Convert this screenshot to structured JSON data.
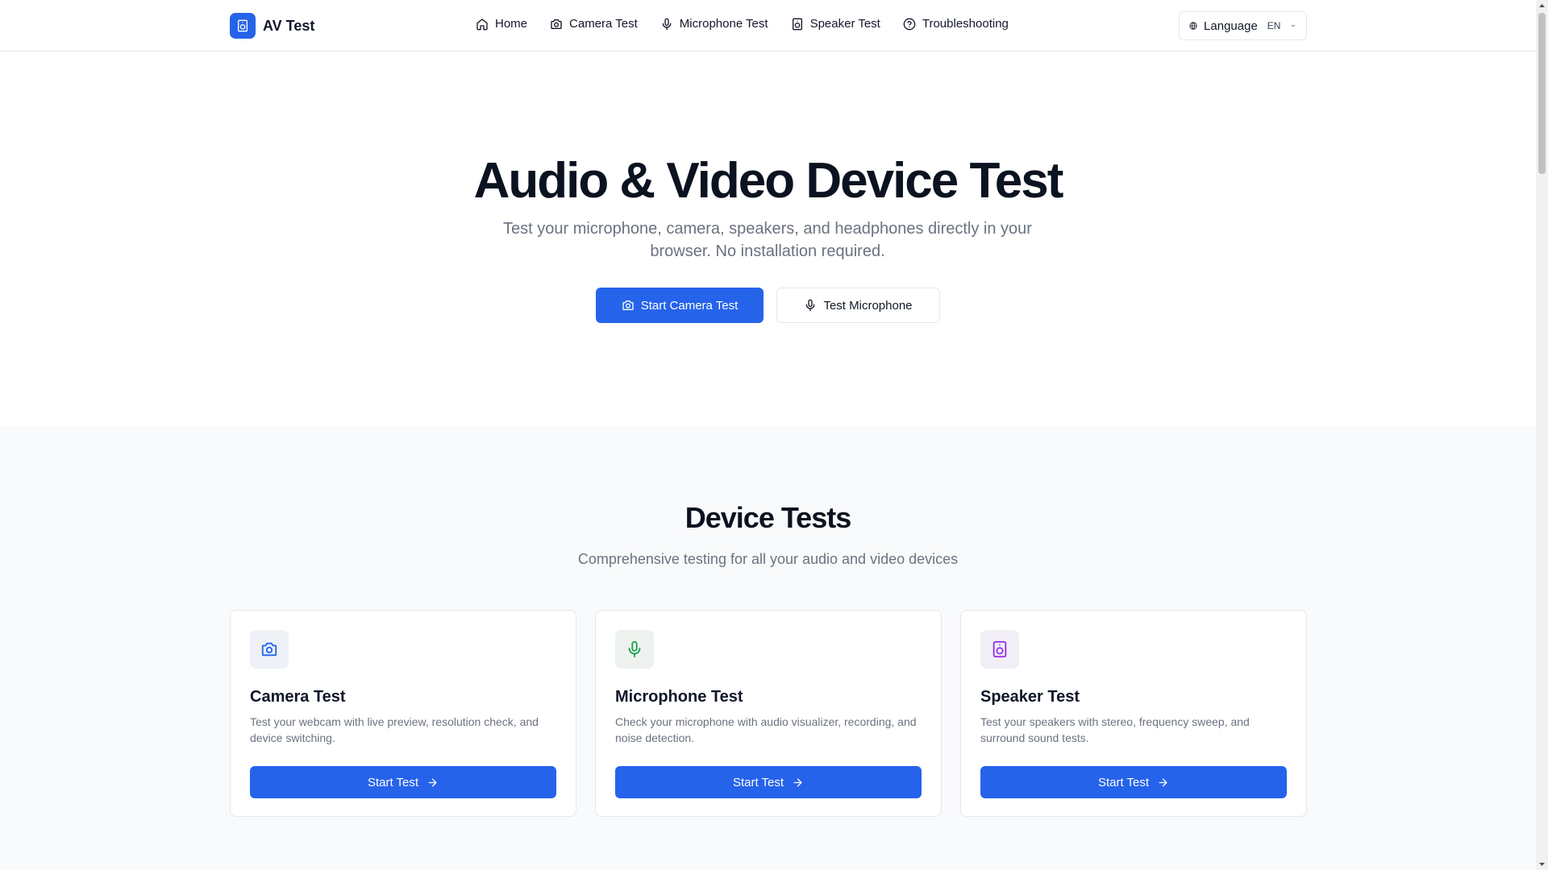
{
  "brand": {
    "name": "AV Test",
    "logo_icon": "speaker-icon",
    "accent": "#2563eb"
  },
  "nav": {
    "items": [
      {
        "label": "Home",
        "icon": "home-icon"
      },
      {
        "label": "Camera Test",
        "icon": "camera-icon"
      },
      {
        "label": "Microphone Test",
        "icon": "mic-icon"
      },
      {
        "label": "Speaker Test",
        "icon": "speaker-icon"
      },
      {
        "label": "Troubleshooting",
        "icon": "help-circle-icon"
      }
    ]
  },
  "language": {
    "label": "Language",
    "code": "EN",
    "icon": "globe-icon"
  },
  "hero": {
    "title": "Audio & Video Device Test",
    "subtitle": "Test your microphone, camera, speakers, and headphones directly in your browser. No installation required.",
    "primary_button": "Start Camera Test",
    "secondary_button": "Test Microphone"
  },
  "section": {
    "title": "Device Tests",
    "subtitle": "Comprehensive testing for all your audio and video devices",
    "cards": [
      {
        "title": "Camera Test",
        "description": "Test your webcam with live preview, resolution check, and device switching.",
        "button": "Start Test",
        "icon": "camera-icon",
        "icon_color": "#2563eb",
        "icon_bg": "#eef2f7"
      },
      {
        "title": "Microphone Test",
        "description": "Check your microphone with audio visualizer, recording, and noise detection.",
        "button": "Start Test",
        "icon": "mic-icon",
        "icon_color": "#16a34a",
        "icon_bg": "#eef2ef"
      },
      {
        "title": "Speaker Test",
        "description": "Test your speakers with stereo, frequency sweep, and surround sound tests.",
        "button": "Start Test",
        "icon": "speaker-icon",
        "icon_color": "#9333ea",
        "icon_bg": "#f1eef5"
      }
    ]
  }
}
